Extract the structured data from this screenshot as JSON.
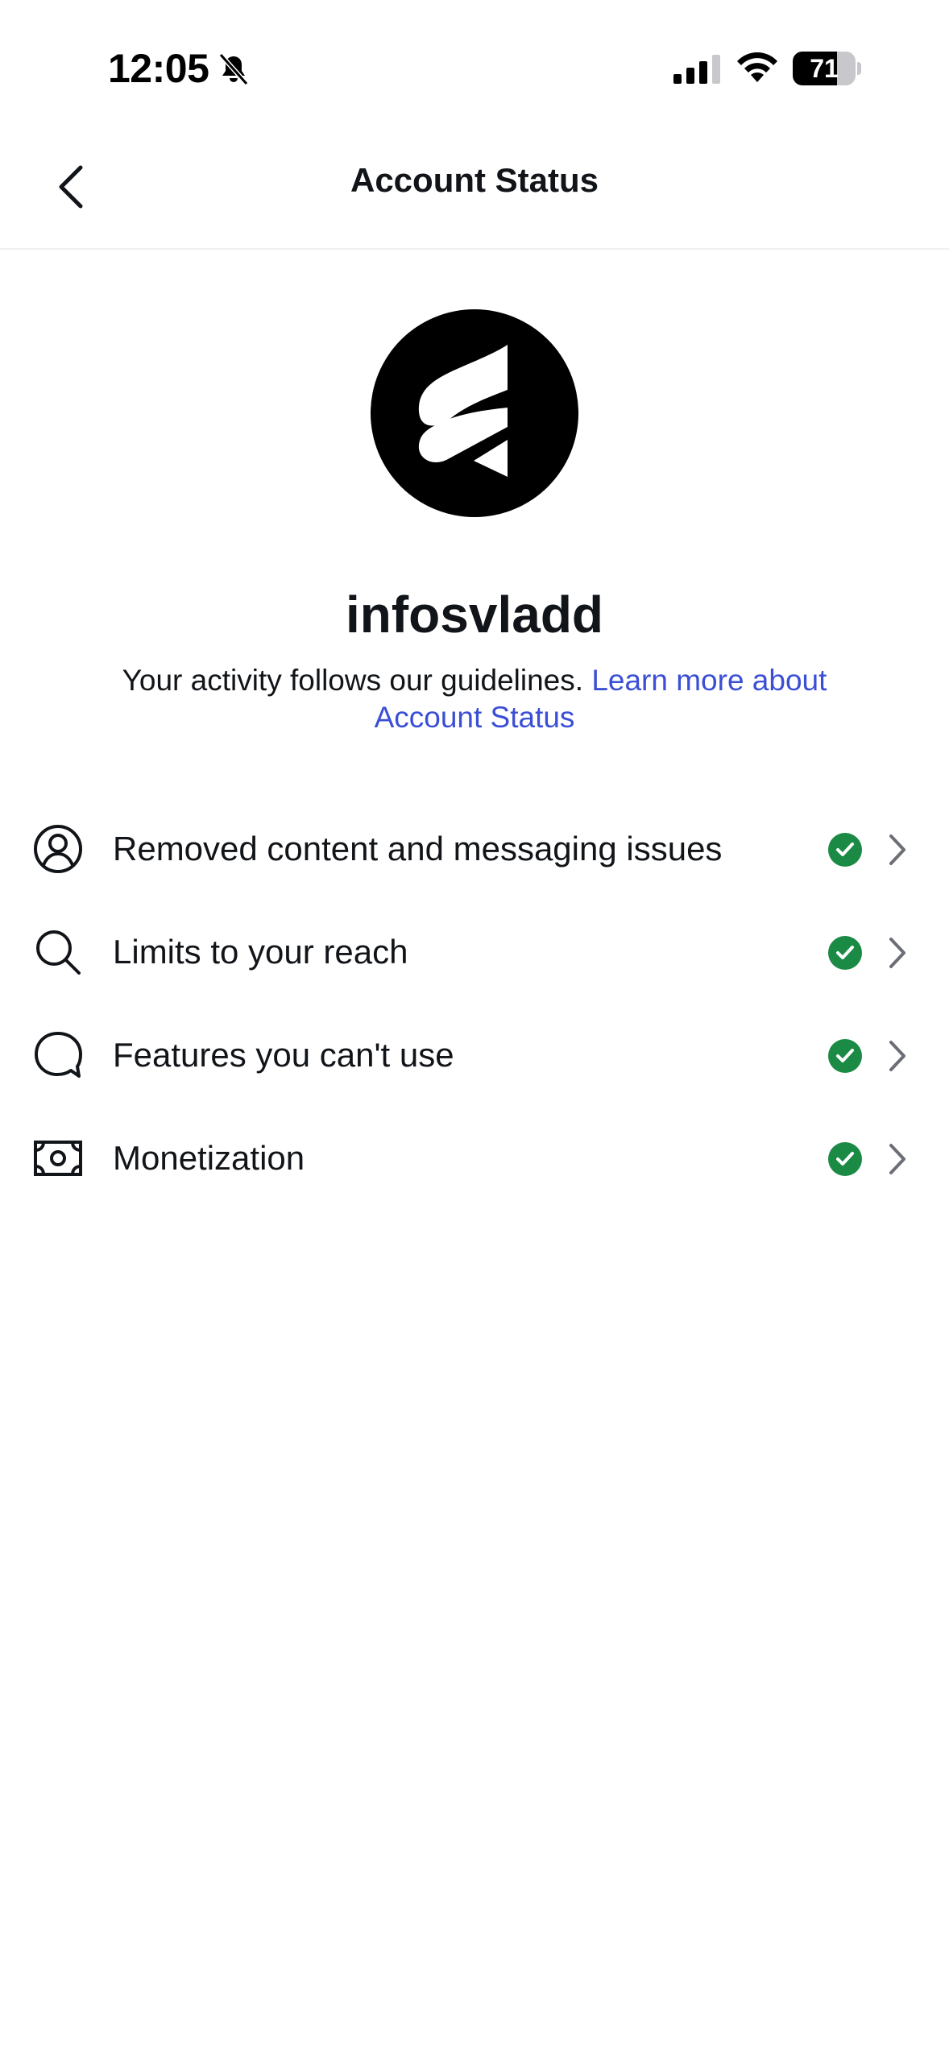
{
  "status_bar": {
    "time": "12:05",
    "battery_level": 71,
    "battery_label": "71",
    "icons": [
      "bell-slash-icon",
      "cellular-signal-icon",
      "wifi-icon",
      "battery-icon"
    ]
  },
  "header": {
    "title": "Account Status",
    "back_icon": "chevron-left-icon"
  },
  "profile": {
    "username": "infosvladd",
    "activity_text": "Your activity follows our guidelines.",
    "learn_more_link": "Learn more about Account Status"
  },
  "items": [
    {
      "label": "Removed content and messaging issues",
      "icon": "user-circle-icon",
      "status": "ok"
    },
    {
      "label": "Limits to your reach",
      "icon": "search-icon",
      "status": "ok"
    },
    {
      "label": "Features you can't use",
      "icon": "chat-bubble-icon",
      "status": "ok"
    },
    {
      "label": "Monetization",
      "icon": "money-icon",
      "status": "ok"
    }
  ],
  "colors": {
    "link": "#3b4fd6",
    "check": "#1a8a44",
    "chevron": "#6b6f75",
    "text": "#111418"
  }
}
